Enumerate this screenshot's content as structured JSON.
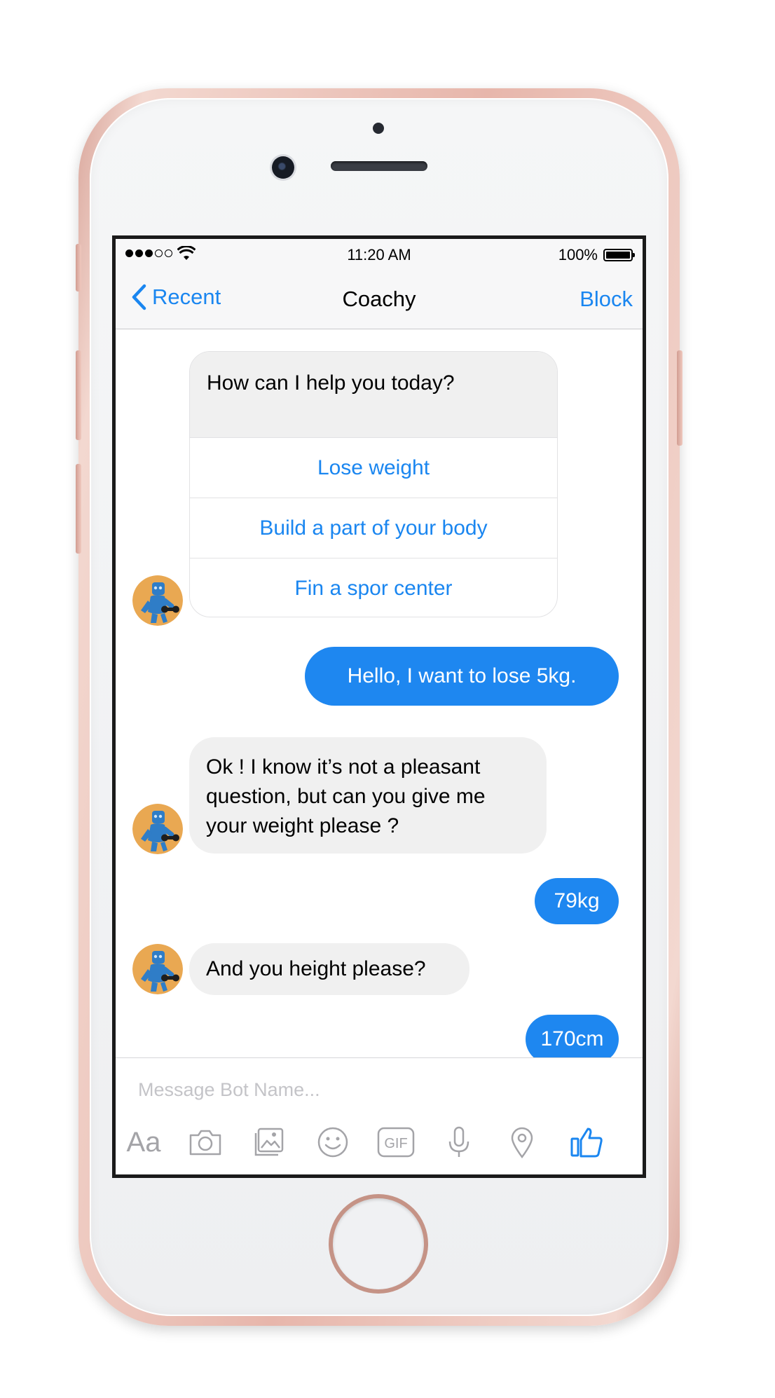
{
  "status_bar": {
    "time": "11:20 AM",
    "battery": "100%"
  },
  "nav": {
    "back_label": "Recent",
    "title": "Coachy",
    "right_label": "Block"
  },
  "card": {
    "prompt": "How can I help you today?",
    "options": [
      "Lose weight",
      "Build a part of your body",
      "Fin a spor center"
    ]
  },
  "messages": {
    "user_1": "Hello, I want to lose 5kg.",
    "bot_2": "Ok ! I know it’s not a pleasant question, but can you give me your weight please ?",
    "user_2": "79kg",
    "bot_3": "And you height please?",
    "user_3": "170cm"
  },
  "composer": {
    "placeholder": "Message Bot Name...",
    "aa_label": "Aa",
    "gif_label": "GIF"
  },
  "colors": {
    "accent": "#1e87f0",
    "incoming_bubble": "#f0f0f0",
    "phone_frame": "#e7b6ab",
    "avatar_bg": "#e9a852",
    "avatar_figure": "#2f7dc7"
  },
  "icons": [
    "chevron-left-icon",
    "wifi-icon",
    "battery-icon",
    "camera-icon",
    "gallery-icon",
    "emoji-icon",
    "gif-icon",
    "microphone-icon",
    "location-pin-icon",
    "thumbs-up-icon"
  ]
}
